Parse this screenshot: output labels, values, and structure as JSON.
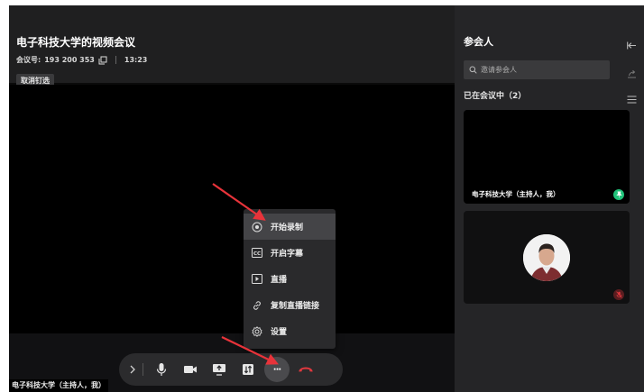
{
  "window": {
    "minimize": "–",
    "maximize": "□",
    "close": "✕"
  },
  "meeting": {
    "title": "电子科技大学的视频会议",
    "id_label": "会议号:",
    "id_value": "193 200 353",
    "time": "13:23",
    "unpin_label": "取消钉选",
    "self_label": "电子科技大学（主持人，我）"
  },
  "more_menu": {
    "items": [
      {
        "label": "开始录制",
        "icon": "record-icon"
      },
      {
        "label": "开启字幕",
        "icon": "cc-icon"
      },
      {
        "label": "直播",
        "icon": "live-icon"
      },
      {
        "label": "复制直播链接",
        "icon": "link-icon"
      },
      {
        "label": "设置",
        "icon": "gear-icon"
      }
    ]
  },
  "toolbar": {
    "more_label": "···"
  },
  "participants": {
    "title": "参会人",
    "search_placeholder": "邀请参会人",
    "in_meeting_label": "已在会议中（2）",
    "cards": [
      {
        "name": "电子科技大学（主持人，我）"
      }
    ]
  },
  "colors": {
    "accent_green": "#21c27a",
    "hangup_red": "#e0383e",
    "annotation_arrow": "#e8333a"
  }
}
